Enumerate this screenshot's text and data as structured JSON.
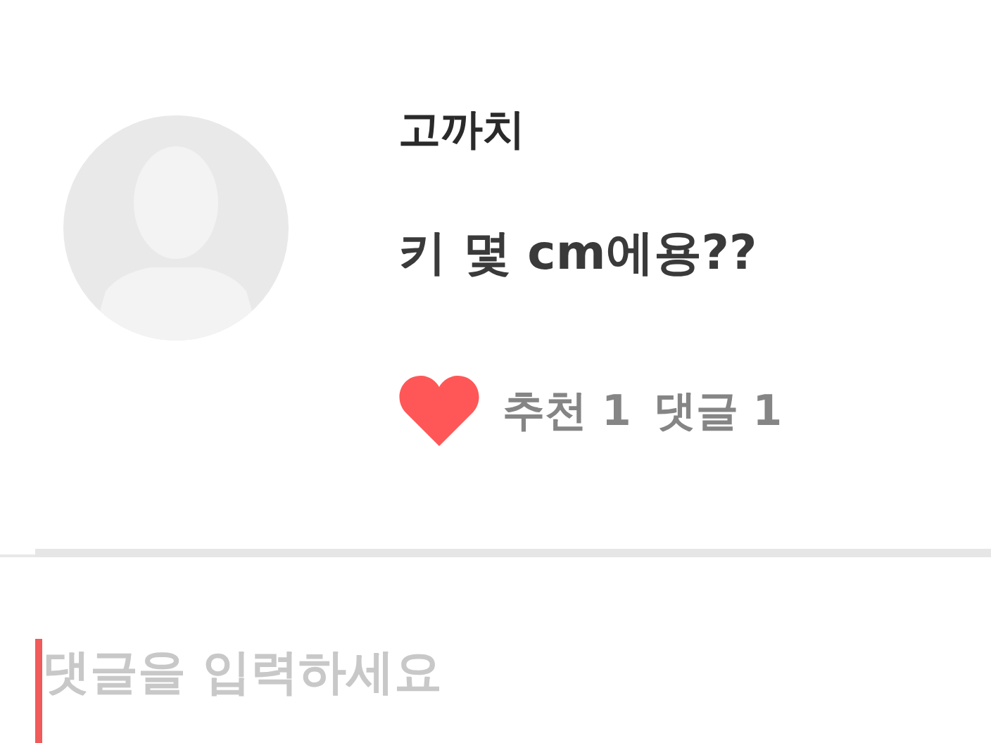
{
  "post": {
    "author": "고까치",
    "text": "키 몇 cm에용??",
    "liked": true,
    "stats": [
      {
        "label": "추천 1"
      },
      {
        "label": "댓글 1"
      }
    ]
  },
  "comment_input": {
    "placeholder": "댓글을 입력하세요"
  }
}
